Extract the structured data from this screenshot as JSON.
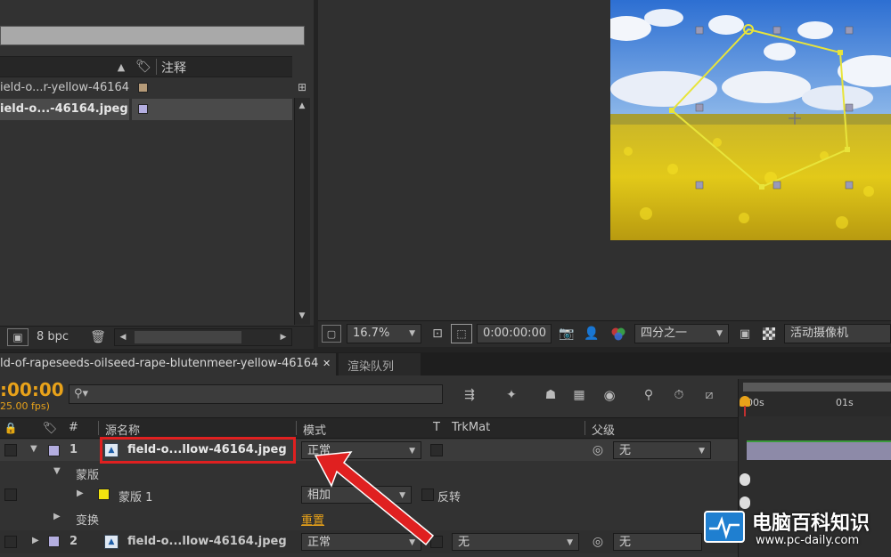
{
  "project": {
    "comment_header": "注释",
    "items": [
      {
        "name": "ield-o...r-yellow-46164",
        "color": "#b59a78"
      },
      {
        "name": "ield-o...-46164.jpeg",
        "color": "#b4aee0"
      }
    ],
    "bpc": "8 bpc"
  },
  "viewer": {
    "zoom": "16.7%",
    "timecode": "0:00:00:00",
    "resolution": "四分之一",
    "camera": "活动摄像机"
  },
  "tabs": {
    "comp": "ld-of-rapeseeds-oilseed-rape-blutenmeer-yellow-46164",
    "render_queue": "渲染队列"
  },
  "timeline": {
    "timecode": ":00:00",
    "fps": "25.00 fps)",
    "search_placeholder": "",
    "columns": {
      "hash": "#",
      "source_name": "源名称",
      "mode": "模式",
      "t": "T",
      "trkmat": "TrkMat",
      "parent": "父级"
    },
    "ruler": {
      "t0": "00s",
      "t1": "01s"
    },
    "layers": {
      "layer1": {
        "num": "1",
        "name": "field-o...llow-46164.jpeg",
        "mode": "正常",
        "parent": "无",
        "color": "#b4aee0"
      },
      "mask_group": "蒙版",
      "mask1": {
        "name": "蒙版 1",
        "mode": "相加",
        "invert": "反转",
        "color": "#f2e30f"
      },
      "transform": "变换",
      "reset": "重置",
      "layer2": {
        "num": "2",
        "name": "field-o...llow-46164.jpeg",
        "mode": "正常",
        "trkmat": "无",
        "parent": "无",
        "color": "#b4aee0"
      }
    }
  },
  "watermark": {
    "title": "电脑百科知识",
    "url": "www.pc-daily.com"
  },
  "colors": {
    "accent_orange": "#e8a21a",
    "mask_yellow": "#e8e43a",
    "highlight_red": "#e02020"
  }
}
